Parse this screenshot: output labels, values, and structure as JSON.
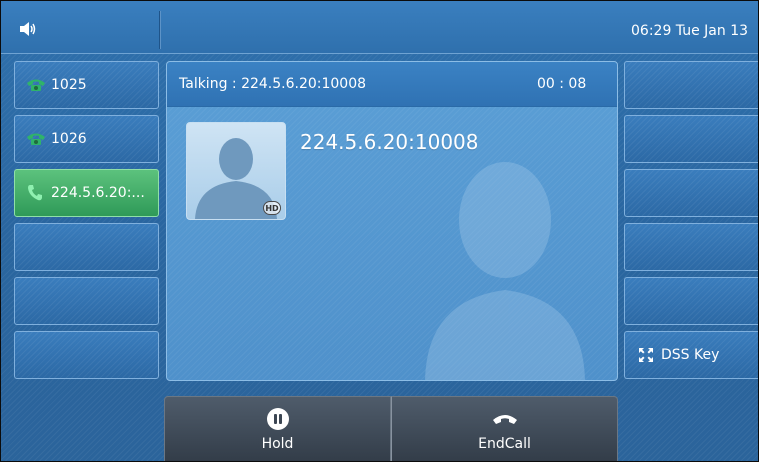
{
  "status_bar": {
    "volume_icon": "speaker-icon",
    "clock": "06:29 Tue Jan 13"
  },
  "line_keys": [
    {
      "label": "1025",
      "icon": "phone-handset-icon",
      "state": "idle"
    },
    {
      "label": "1026",
      "icon": "phone-handset-icon",
      "state": "idle"
    },
    {
      "label": "224.5.6.20:...",
      "icon": "phone-handset-icon",
      "state": "active"
    },
    {
      "label": ""
    },
    {
      "label": ""
    },
    {
      "label": ""
    }
  ],
  "dss_keys": [
    {
      "label": ""
    },
    {
      "label": ""
    },
    {
      "label": ""
    },
    {
      "label": ""
    },
    {
      "label": ""
    },
    {
      "label": "DSS Key",
      "icon": "expand-icon"
    }
  ],
  "call": {
    "status_text": "Talking : 224.5.6.20:10008",
    "duration": "00 : 08",
    "caller": "224.5.6.20:10008",
    "hd_badge": "HD"
  },
  "softkeys": {
    "hold": "Hold",
    "end_call": "EndCall"
  },
  "colors": {
    "active_line": "#2f9a58",
    "handset_idle": "#2fb36a",
    "background": "#2f71ad"
  }
}
